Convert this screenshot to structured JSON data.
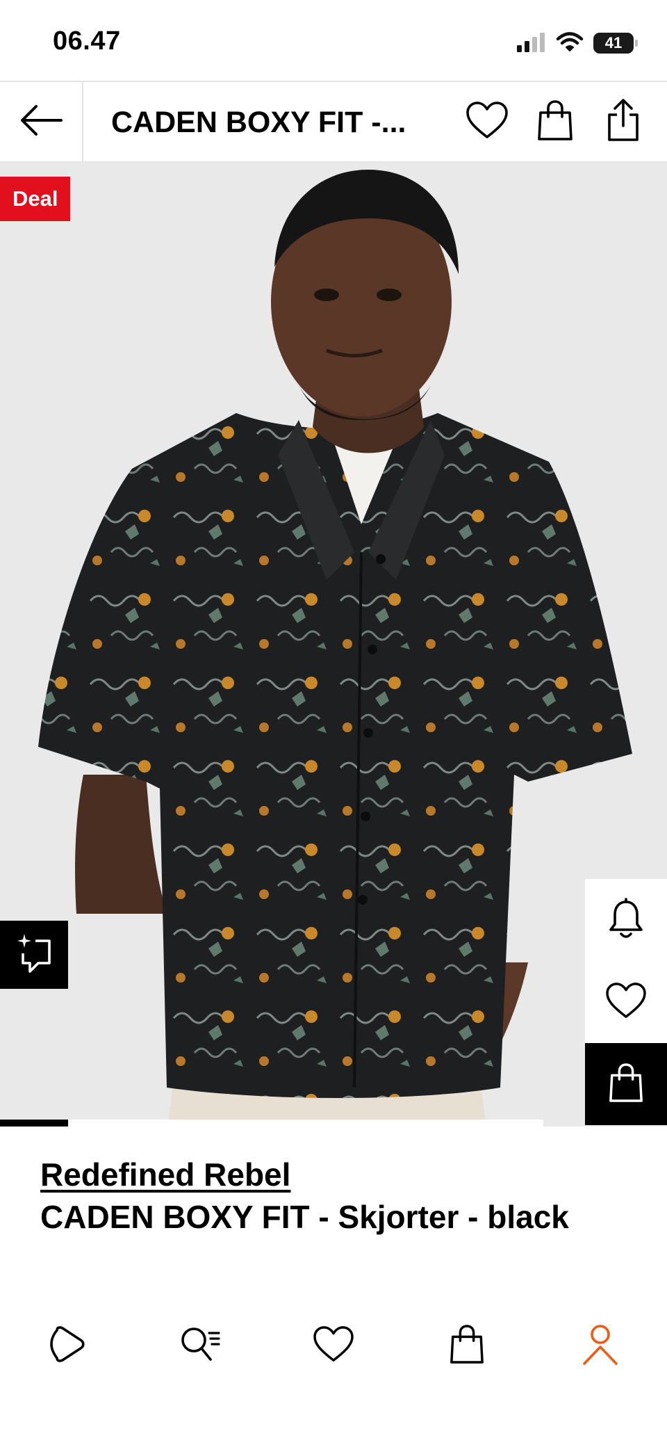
{
  "status_bar": {
    "time": "06.47",
    "battery": "41"
  },
  "header": {
    "title": "CADEN BOXY FIT - Skjorter - black",
    "title_truncated": "CADEN BOXY FIT -..."
  },
  "gallery": {
    "badge": "Deal",
    "image_position": 1,
    "image_count": 8,
    "progress_fraction": 0.125
  },
  "product": {
    "brand": "Redefined Rebel",
    "name": "CADEN BOXY FIT - Skjorter - black"
  },
  "icons": {
    "back": "arrow-left-icon",
    "wishlist": "heart-icon",
    "bag": "shopping-bag-icon",
    "share": "share-icon",
    "similar": "similar-items-icon",
    "notify": "bell-icon",
    "add_to_bag": "shopping-bag-icon",
    "nav": [
      "play-icon",
      "search-list-icon",
      "heart-icon",
      "shopping-bag-icon",
      "user-icon"
    ]
  },
  "colors": {
    "deal": "#e2101d",
    "active_nav": "#f05a14",
    "background": "#e9e9ea"
  }
}
